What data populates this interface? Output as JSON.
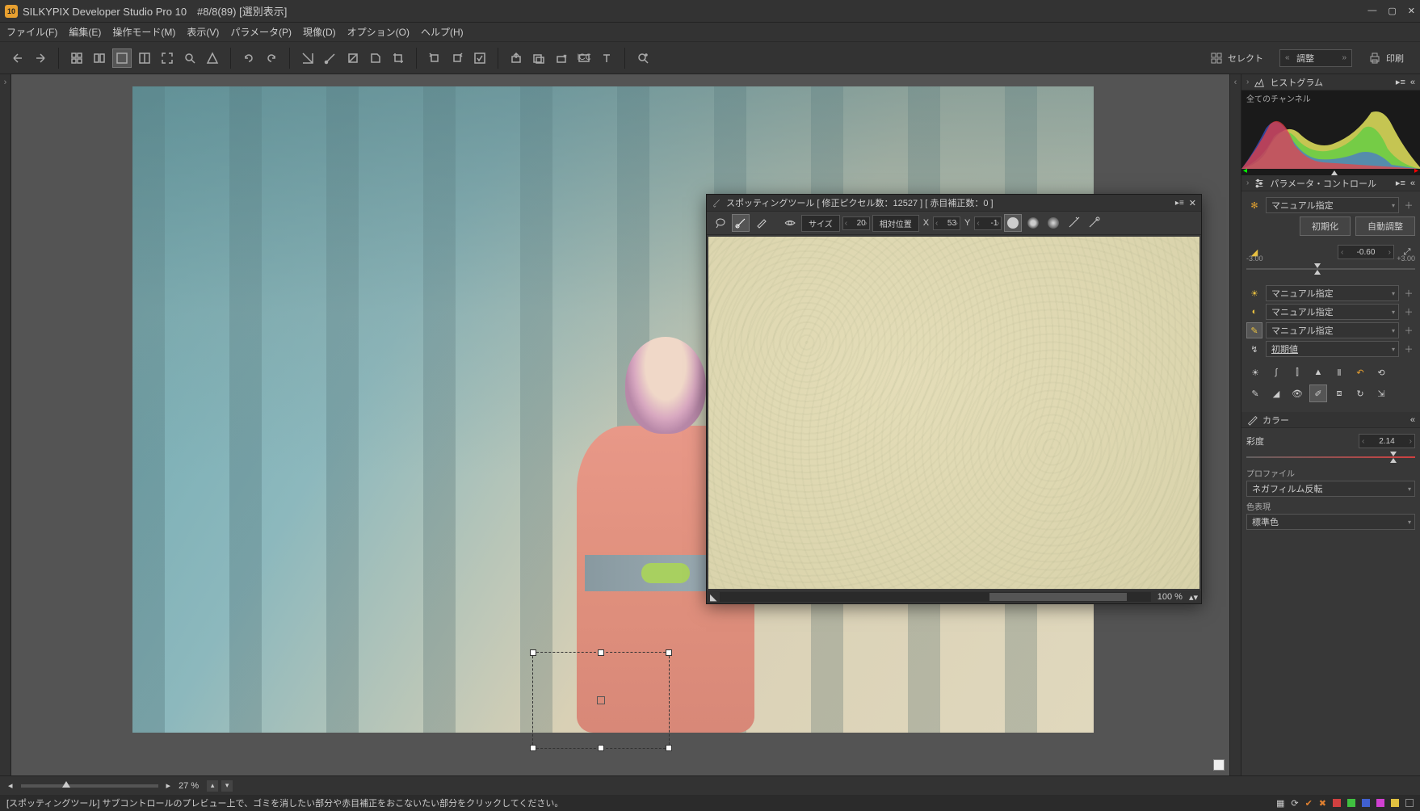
{
  "titlebar": {
    "app_icon_text": "10",
    "title": "SILKYPIX Developer Studio Pro 10　#8/8(89) [選別表示]"
  },
  "menu": {
    "file": "ファイル(F)",
    "edit": "編集(E)",
    "mode": "操作モード(M)",
    "view": "表示(V)",
    "param": "パラメータ(P)",
    "develop": "現像(D)",
    "option": "オプション(O)",
    "help": "ヘルプ(H)"
  },
  "toolbar": {
    "select_label": "セレクト",
    "dropdown_label": "調整",
    "print_label": "印刷"
  },
  "spotting": {
    "title": "スポッティングツール [ 修正ピクセル数：12527 ] [ 赤目補正数：0 ]",
    "size_label": "サイズ",
    "size_value": "20",
    "mode_label": "相対位置",
    "x_label": "X",
    "x_value": "53",
    "y_label": "Y",
    "y_value": "-1",
    "zoom": "100",
    "pct": "%"
  },
  "bottom": {
    "zoom_value": "27",
    "pct": "%"
  },
  "status": {
    "text": "[スポッティングツール] サブコントロールのプレビュー上で、ゴミを消したい部分や赤目補正をおこないたい部分をクリックしてください。"
  },
  "panel": {
    "histogram_title": "ヒストグラム",
    "histogram_channel": "全てのチャンネル",
    "param_title": "パラメータ・コントロール",
    "exposure_mode": "マニュアル指定",
    "btn_init": "初期化",
    "btn_auto": "自動調整",
    "ev_value": "-0.60",
    "ev_min": "-3.00",
    "ev_max": "+3.00",
    "wb_mode": "マニュアル指定",
    "contrast_mode": "マニュアル指定",
    "tone_mode": "マニュアル指定",
    "preset": "初期値",
    "color_title": "カラー",
    "saturation_label": "彩度",
    "saturation_value": "2.14",
    "profile_label": "プロファイル",
    "profile_value": "ネガフィルム反転",
    "color_rep_label": "色表現",
    "color_rep_value": "標準色"
  }
}
